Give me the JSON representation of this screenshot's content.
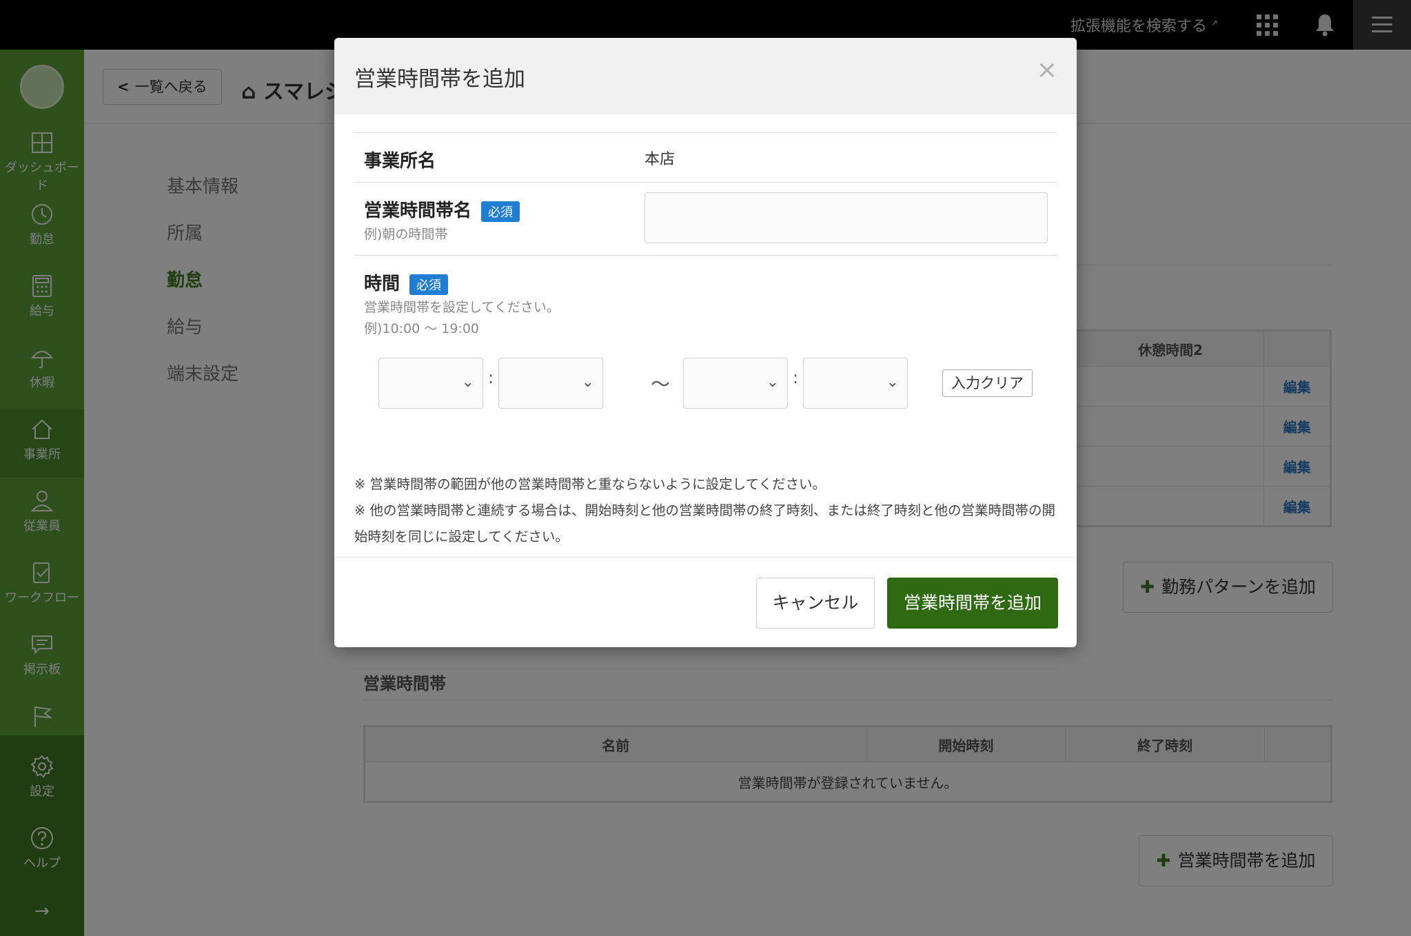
{
  "topbar": {
    "ext_search_label": "拡張機能を検索する",
    "ext_icon": "external-link-icon",
    "apps_icon": "apps-grid-icon",
    "bell_icon": "bell-icon",
    "menu_icon": "hamburger-menu-icon"
  },
  "sidebar": {
    "items": [
      {
        "label": "ダッシュボード",
        "icon": "dashboard-icon"
      },
      {
        "label": "勤怠",
        "icon": "clock-icon"
      },
      {
        "label": "給与",
        "icon": "calculator-icon"
      },
      {
        "label": "休暇",
        "icon": "umbrella-icon"
      },
      {
        "label": "事業所",
        "icon": "home-icon"
      },
      {
        "label": "従業員",
        "icon": "person-icon"
      },
      {
        "label": "ワークフロー",
        "icon": "checklist-icon"
      },
      {
        "label": "掲示板",
        "icon": "message-icon"
      },
      {
        "label": "",
        "icon": "flag-icon"
      },
      {
        "label": "設定",
        "icon": "gear-icon"
      },
      {
        "label": "ヘルプ",
        "icon": "help-icon"
      }
    ],
    "active_index": 4,
    "expand_icon": "→"
  },
  "header": {
    "back_label": "一覧へ戻る",
    "title": "スマレジ"
  },
  "subnav": {
    "items": [
      "基本情報",
      "所属",
      "勤怠",
      "給与",
      "端末設定"
    ],
    "active_index": 2
  },
  "background": {
    "break_table_header": "休憩時間2",
    "edit_label": "編集",
    "add_pattern_label": "勤務パターンを追加",
    "business_hours_section": "営業時間帯",
    "bh_columns": [
      "名前",
      "開始時刻",
      "終了時刻",
      ""
    ],
    "bh_empty": "営業時間帯が登録されていません。",
    "add_bh_label": "営業時間帯を追加"
  },
  "modal": {
    "title": "営業時間帯を追加",
    "close_icon": "×",
    "office_label": "事業所名",
    "office_value": "本店",
    "name_label": "営業時間帯名",
    "required_badge": "必須",
    "name_hint": "例)朝の時間帯",
    "name_value": "",
    "time_label": "時間",
    "time_hint1": "営業時間帯を設定してください。",
    "time_hint2": "例)10:00 ～ 19:00",
    "colon": ":",
    "tilde": "～",
    "clear_label": "入力クリア",
    "note1": "※ 営業時間帯の範囲が他の営業時間帯と重ならないように設定してください。",
    "note2": "※ 他の営業時間帯と連続する場合は、開始時刻と他の営業時間帯の終了時刻、または終了時刻と他の営業時間帯の開始時刻を同じに設定してください。",
    "cancel_label": "キャンセル",
    "submit_label": "営業時間帯を追加"
  },
  "colors": {
    "sidebar": "#5ba038",
    "sidebar_dark": "#3f7a22",
    "primary_button": "#2f6a12",
    "required_badge": "#1f7ed3",
    "link": "#2b77c6"
  }
}
